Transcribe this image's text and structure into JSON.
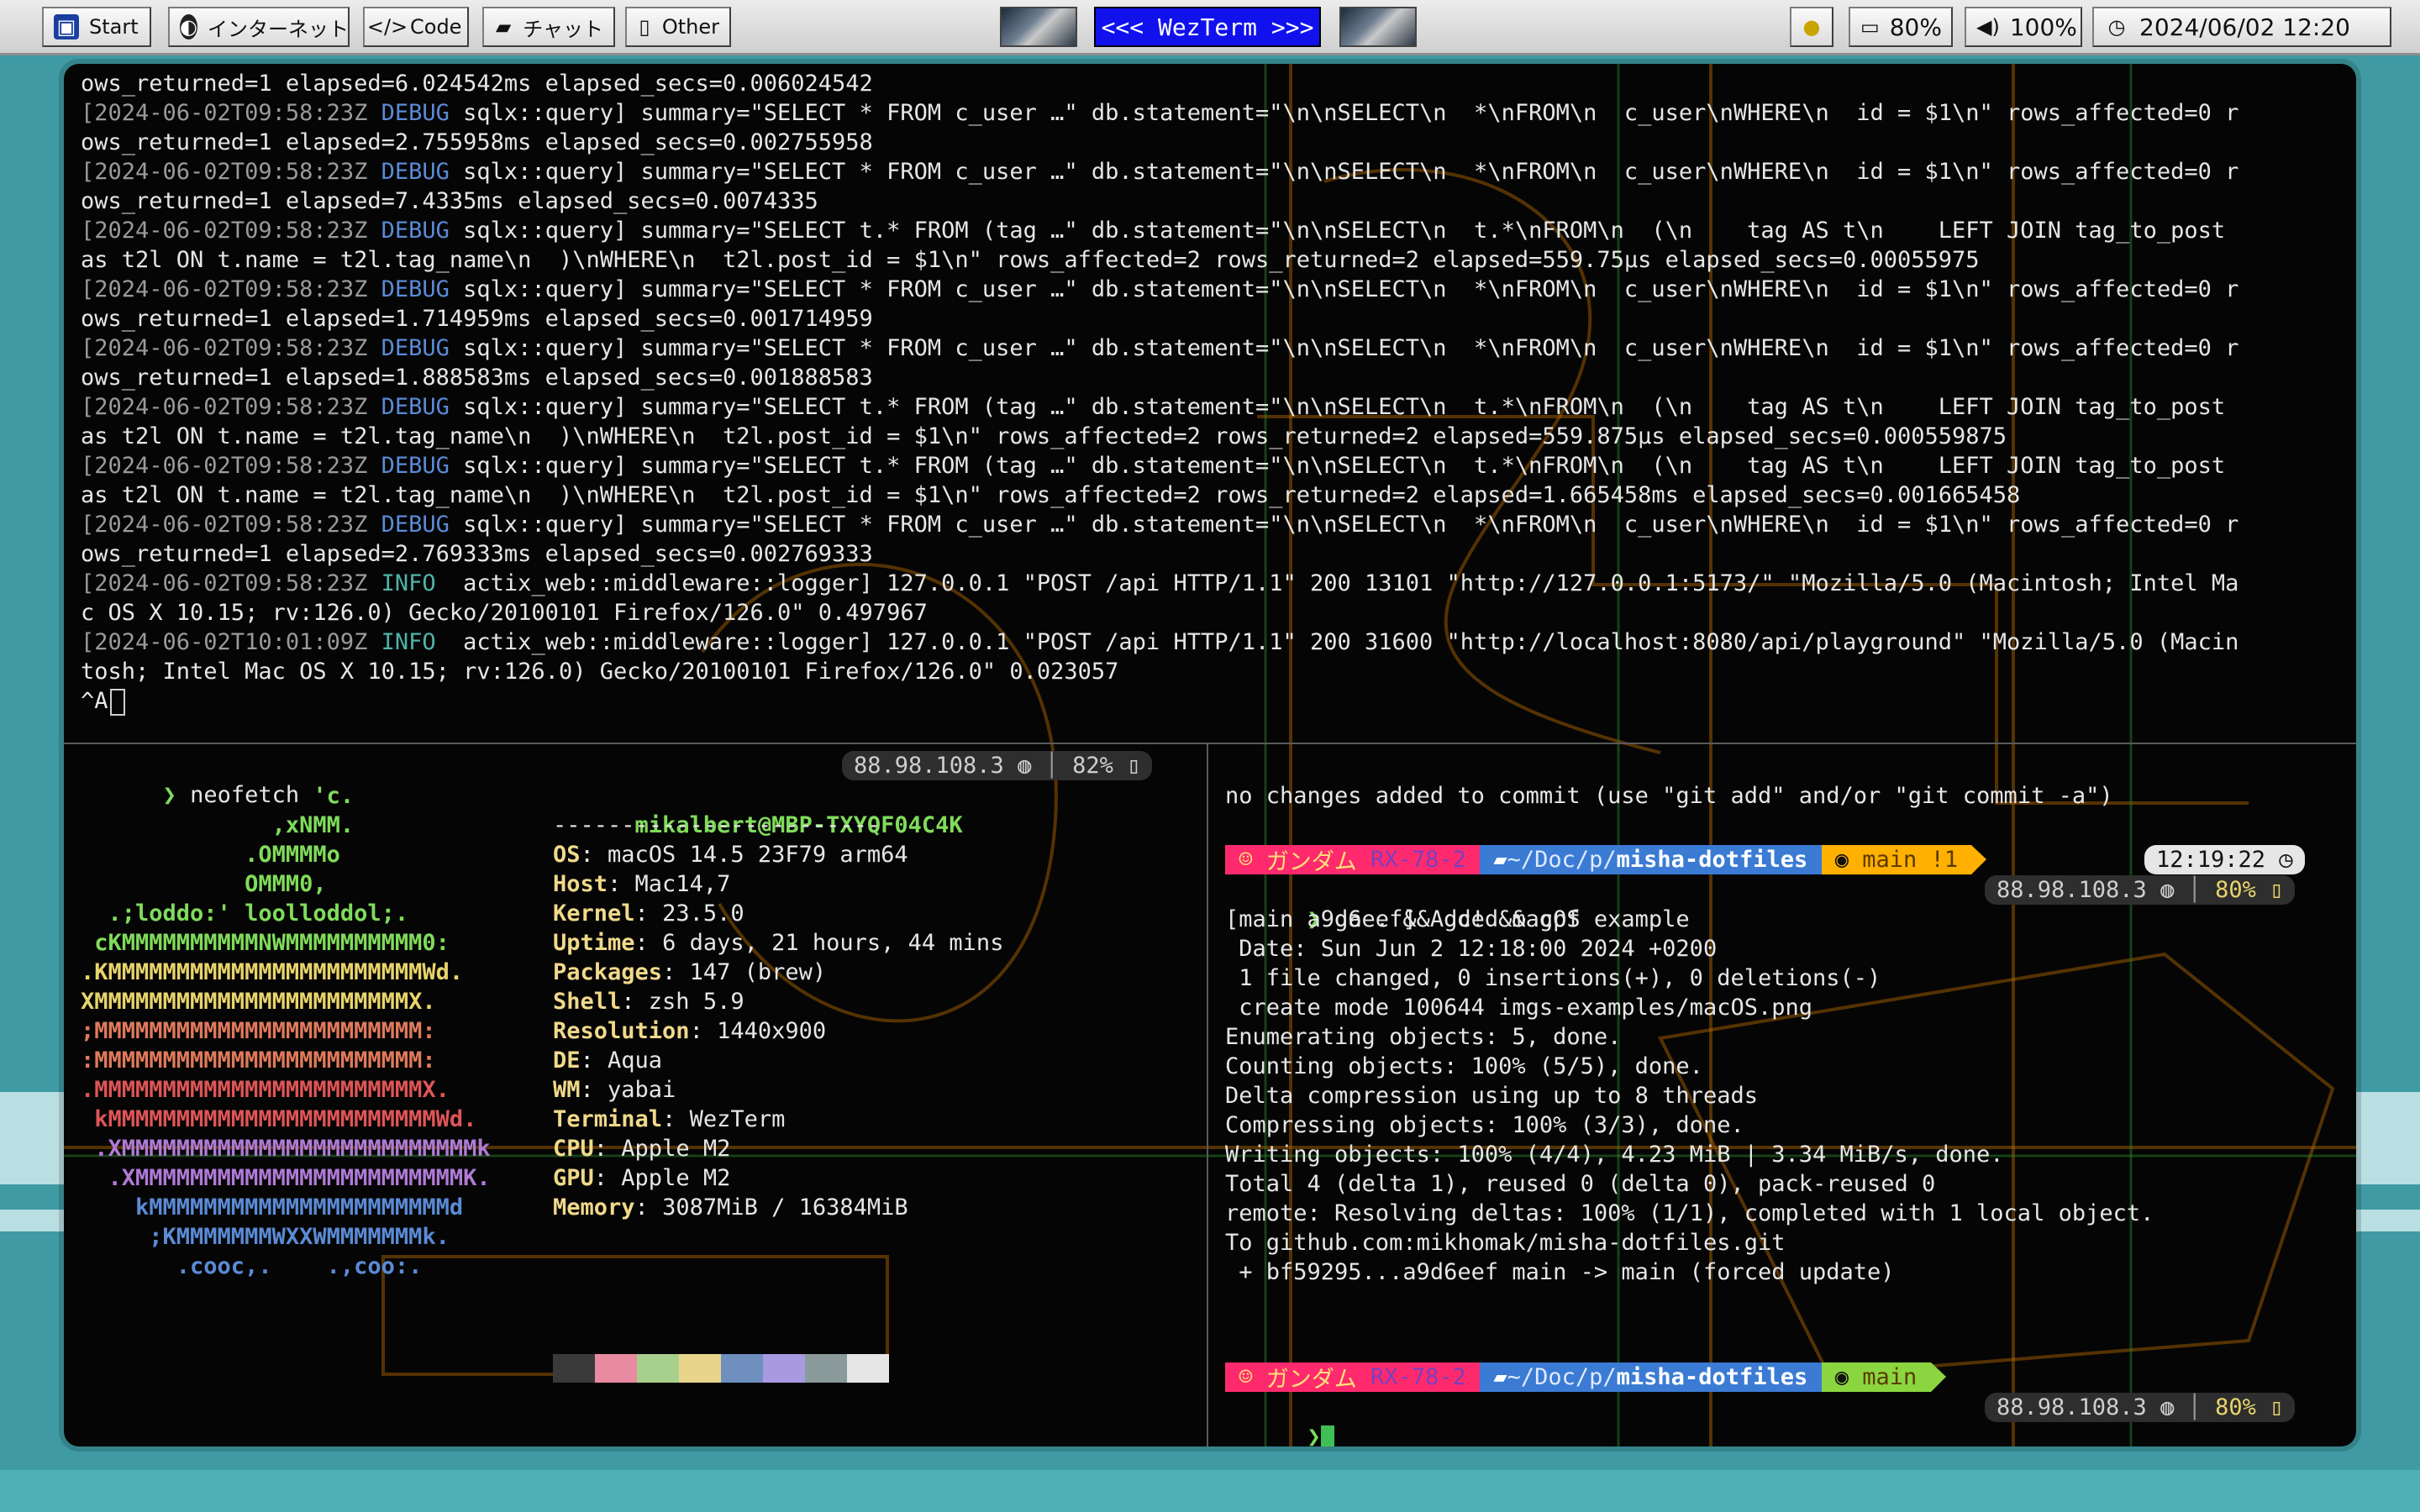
{
  "desktop": {
    "stripe_color": "#b9dfe2",
    "background": "#3f9aa3"
  },
  "taskbar": {
    "start": "Start",
    "internet": "インターネット",
    "code": "Code",
    "chat": "チャット",
    "other": "Other",
    "title": "<<< WezTerm >>>",
    "battery": "80%",
    "volume": "100%",
    "clock": "2024/06/02 12:20"
  },
  "log": {
    "lines": [
      "ows_returned=1 elapsed=6.024542ms elapsed_secs=0.006024542",
      "[2024-06-02T09:58:23Z DEBUG sqlx::query] summary=\"SELECT * FROM c_user …\" db.statement=\"\\n\\nSELECT\\n  *\\nFROM\\n  c_user\\nWHERE\\n  id = $1\\n\" rows_affected=0 r",
      "ows_returned=1 elapsed=2.755958ms elapsed_secs=0.002755958",
      "[2024-06-02T09:58:23Z DEBUG sqlx::query] summary=\"SELECT * FROM c_user …\" db.statement=\"\\n\\nSELECT\\n  *\\nFROM\\n  c_user\\nWHERE\\n  id = $1\\n\" rows_affected=0 r",
      "ows_returned=1 elapsed=7.4335ms elapsed_secs=0.0074335",
      "[2024-06-02T09:58:23Z DEBUG sqlx::query] summary=\"SELECT t.* FROM (tag …\" db.statement=\"\\n\\nSELECT\\n  t.*\\nFROM\\n  (\\n    tag AS t\\n    LEFT JOIN tag_to_post",
      "as t2l ON t.name = t2l.tag_name\\n  )\\nWHERE\\n  t2l.post_id = $1\\n\" rows_affected=2 rows_returned=2 elapsed=559.75µs elapsed_secs=0.00055975",
      "[2024-06-02T09:58:23Z DEBUG sqlx::query] summary=\"SELECT * FROM c_user …\" db.statement=\"\\n\\nSELECT\\n  *\\nFROM\\n  c_user\\nWHERE\\n  id = $1\\n\" rows_affected=0 r",
      "ows_returned=1 elapsed=1.714959ms elapsed_secs=0.001714959",
      "[2024-06-02T09:58:23Z DEBUG sqlx::query] summary=\"SELECT * FROM c_user …\" db.statement=\"\\n\\nSELECT\\n  *\\nFROM\\n  c_user\\nWHERE\\n  id = $1\\n\" rows_affected=0 r",
      "ows_returned=1 elapsed=1.888583ms elapsed_secs=0.001888583",
      "[2024-06-02T09:58:23Z DEBUG sqlx::query] summary=\"SELECT t.* FROM (tag …\" db.statement=\"\\n\\nSELECT\\n  t.*\\nFROM\\n  (\\n    tag AS t\\n    LEFT JOIN tag_to_post",
      "as t2l ON t.name = t2l.tag_name\\n  )\\nWHERE\\n  t2l.post_id = $1\\n\" rows_affected=2 rows_returned=2 elapsed=559.875µs elapsed_secs=0.000559875",
      "[2024-06-02T09:58:23Z DEBUG sqlx::query] summary=\"SELECT t.* FROM (tag …\" db.statement=\"\\n\\nSELECT\\n  t.*\\nFROM\\n  (\\n    tag AS t\\n    LEFT JOIN tag_to_post",
      "as t2l ON t.name = t2l.tag_name\\n  )\\nWHERE\\n  t2l.post_id = $1\\n\" rows_affected=2 rows_returned=2 elapsed=1.665458ms elapsed_secs=0.001665458",
      "[2024-06-02T09:58:23Z DEBUG sqlx::query] summary=\"SELECT * FROM c_user …\" db.statement=\"\\n\\nSELECT\\n  *\\nFROM\\n  c_user\\nWHERE\\n  id = $1\\n\" rows_affected=0 r",
      "ows_returned=1 elapsed=2.769333ms elapsed_secs=0.002769333",
      "[2024-06-02T09:58:23Z INFO  actix_web::middleware::logger] 127.0.0.1 \"POST /api HTTP/1.1\" 200 13101 \"http://127.0.0.1:5173/\" \"Mozilla/5.0 (Macintosh; Intel Ma",
      "c OS X 10.15; rv:126.0) Gecko/20100101 Firefox/126.0\" 0.497967",
      "[2024-06-02T10:01:09Z INFO  actix_web::middleware::logger] 127.0.0.1 \"POST /api HTTP/1.1\" 200 31600 \"http://localhost:8080/api/playground\" \"Mozilla/5.0 (Macin",
      "tosh; Intel Mac OS X 10.15; rv:126.0) Gecko/20100101 Firefox/126.0\" 0.023057",
      "^A"
    ]
  },
  "left_pane": {
    "command": "neofetch",
    "ip": "88.98.108.3",
    "battery": "82%",
    "logo": [
      {
        "text": "                 'c.",
        "color": "#7fdc5a"
      },
      {
        "text": "              ,xNMM.",
        "color": "#7fdc5a"
      },
      {
        "text": "            .OMMMMo",
        "color": "#7fdc5a"
      },
      {
        "text": "            OMMM0,",
        "color": "#7fdc5a"
      },
      {
        "text": "  .;loddo:' loolloddol;.",
        "color": "#7fdc5a"
      },
      {
        "text": " cKMMMMMMMMMMNWMMMMMMMMMM0:",
        "color": "#7fdc5a"
      },
      {
        "text": ".KMMMMMMMMMMMMMMMMMMMMMMMWd.",
        "color": "#e8d46b"
      },
      {
        "text": "XMMMMMMMMMMMMMMMMMMMMMMMX.",
        "color": "#e8d46b"
      },
      {
        "text": ";MMMMMMMMMMMMMMMMMMMMMMMM:",
        "color": "#e07a5a"
      },
      {
        "text": ":MMMMMMMMMMMMMMMMMMMMMMMM:",
        "color": "#e07a5a"
      },
      {
        "text": ".MMMMMMMMMMMMMMMMMMMMMMMMX.",
        "color": "#e05555"
      },
      {
        "text": " kMMMMMMMMMMMMMMMMMMMMMMMMWd.",
        "color": "#e05555"
      },
      {
        "text": " .XMMMMMMMMMMMMMMMMMMMMMMMMMMk",
        "color": "#b07ad6"
      },
      {
        "text": "  .XMMMMMMMMMMMMMMMMMMMMMMMMK.",
        "color": "#b07ad6"
      },
      {
        "text": "    kMMMMMMMMMMMMMMMMMMMMMMd",
        "color": "#5a8bd6"
      },
      {
        "text": "     ;KMMMMMMMWXXWMMMMMMMk.",
        "color": "#5a8bd6"
      },
      {
        "text": "       .cooc,.    .,coo:.",
        "color": "#5a8bd6"
      }
    ],
    "user_host": "mikalbert@MBP-TXYQF04C4K",
    "separator": "------------------------",
    "info": [
      {
        "key": "OS",
        "value": "macOS 14.5 23F79 arm64"
      },
      {
        "key": "Host",
        "value": "Mac14,7"
      },
      {
        "key": "Kernel",
        "value": "23.5.0"
      },
      {
        "key": "Uptime",
        "value": "6 days, 21 hours, 44 mins"
      },
      {
        "key": "Packages",
        "value": "147 (brew)"
      },
      {
        "key": "Shell",
        "value": "zsh 5.9"
      },
      {
        "key": "Resolution",
        "value": "1440x900"
      },
      {
        "key": "DE",
        "value": "Aqua"
      },
      {
        "key": "WM",
        "value": "yabai"
      },
      {
        "key": "Terminal",
        "value": "WezTerm"
      },
      {
        "key": "CPU",
        "value": "Apple M2"
      },
      {
        "key": "GPU",
        "value": "Apple M2"
      },
      {
        "key": "Memory",
        "value": "3087MiB / 16384MiB"
      }
    ],
    "palette": [
      "#3a3a3a",
      "#e88aa0",
      "#a8d08d",
      "#e8d48b",
      "#6f8fbf",
      "#a89ae0",
      "#8a9a9a",
      "#e6e6e6"
    ]
  },
  "right_pane": {
    "top_msg": "no changes added to commit (use \"git add\" and/or \"git commit -a\")",
    "prompt": {
      "host_jp": "ガンダム",
      "model": "RX-78-2",
      "path_prefix": "~/Doc/p/",
      "repo": "misha-dotfiles",
      "branch": "main",
      "dirty": "!1",
      "time": "12:19:22"
    },
    "command": "ga . && gc! && gpf",
    "ip": "88.98.108.3",
    "battery": "80%",
    "output": [
      "[main a9d6eef] Added macOS example",
      " Date: Sun Jun 2 12:18:00 2024 +0200",
      " 1 file changed, 0 insertions(+), 0 deletions(-)",
      " create mode 100644 imgs-examples/macOS.png",
      "Enumerating objects: 5, done.",
      "Counting objects: 100% (5/5), done.",
      "Delta compression using up to 8 threads",
      "Compressing objects: 100% (3/3), done.",
      "Writing objects: 100% (4/4), 4.23 MiB | 3.34 MiB/s, done.",
      "Total 4 (delta 1), reused 0 (delta 0), pack-reused 0",
      "remote: Resolving deltas: 100% (1/1), completed with 1 local object.",
      "To github.com:mikhomak/misha-dotfiles.git",
      " + bf59295...a9d6eef main -> main (forced update)"
    ],
    "prompt2_branch": "main"
  }
}
